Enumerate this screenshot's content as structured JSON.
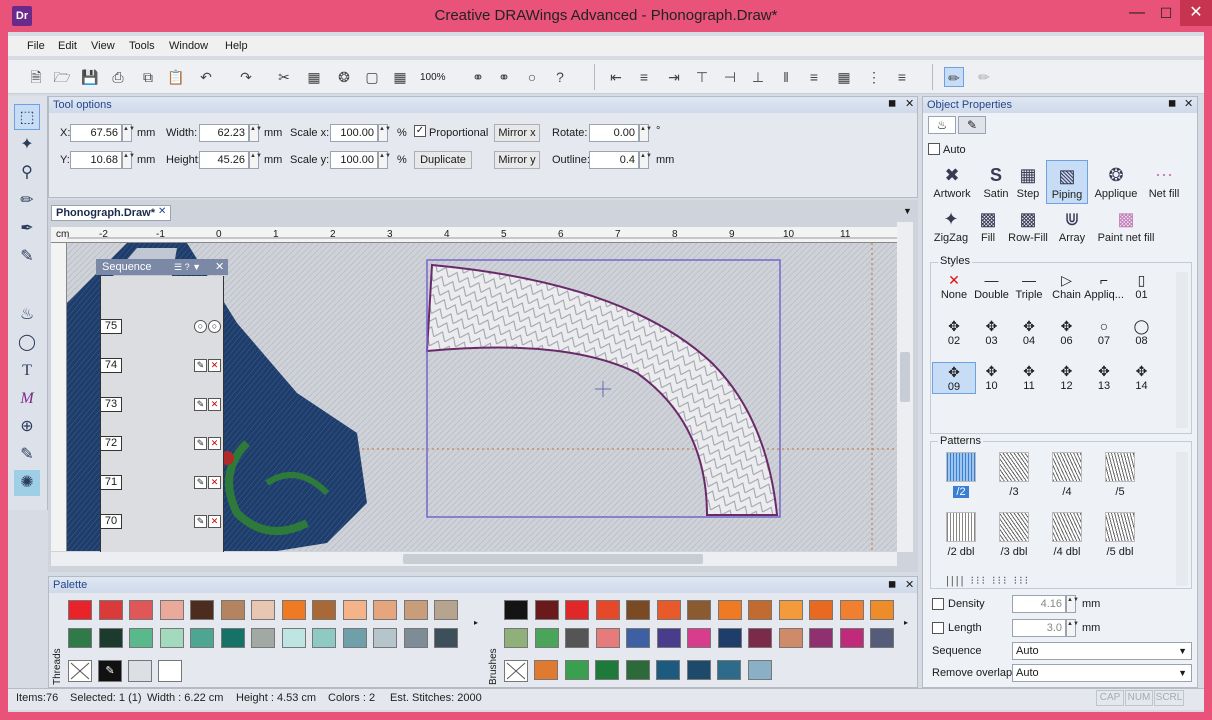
{
  "window": {
    "title": "Creative DRAWings Advanced - Phonograph.Draw*",
    "app_icon": "Dr"
  },
  "menu": [
    "File",
    "Edit",
    "View",
    "Tools",
    "Window",
    "Help"
  ],
  "toolbar": {
    "zoom": "100%"
  },
  "tool_options": {
    "title": "Tool options",
    "x_label": "X:",
    "x_value": "67.56",
    "x_unit": "mm",
    "y_label": "Y:",
    "y_value": "10.68",
    "y_unit": "mm",
    "width_label": "Width:",
    "width_value": "62.23",
    "width_unit": "mm",
    "height_label": "Height:",
    "height_value": "45.26",
    "height_unit": "mm",
    "scalex_label": "Scale x:",
    "scalex_value": "100.00",
    "scalex_unit": "%",
    "scaley_label": "Scale y:",
    "scaley_value": "100.00",
    "scaley_unit": "%",
    "proportional_label": "Proportional",
    "proportional_checked": true,
    "duplicate_label": "Duplicate",
    "mirrorx_label": "Mirror x",
    "mirrory_label": "Mirror y",
    "rotate_label": "Rotate:",
    "rotate_value": "0.00",
    "rotate_unit": "°",
    "outline_label": "Outline:",
    "outline_value": "0.4",
    "outline_unit": "mm"
  },
  "document": {
    "tab_label": "Phonograph.Draw*",
    "ruler_unit": "cm",
    "ruler_ticks": [
      "-2",
      "-1",
      "0",
      "1",
      "2",
      "3",
      "4",
      "5",
      "6",
      "7",
      "8",
      "9",
      "10",
      "11"
    ]
  },
  "sequence": {
    "title": "Sequence",
    "rows": [
      "75",
      "74",
      "73",
      "72",
      "71",
      "70"
    ]
  },
  "palette": {
    "title": "Palette",
    "threads_label": "Threads",
    "brushes_label": "Brushes",
    "threads_row1": [
      "#e8242a",
      "#d93b3b",
      "#e05757",
      "#e9a99b",
      "#4d2c20",
      "#b3845f",
      "#e8c7b2",
      "#ef7a24",
      "#a86838",
      "#f5b38a",
      "#e5a67d",
      "#c89d7a",
      "#b7a48f"
    ],
    "threads_row2": [
      "#2e7a48",
      "#1d3a2e",
      "#5ab98c",
      "#a3d9bd",
      "#4ea591",
      "#167267",
      "#a2a9a4",
      "#bfe5e2",
      "#8fc9c3",
      "#6f9fa9",
      "#b6c4cc",
      "#7d8c96",
      "#3d4f5a"
    ],
    "brushes_row1": [
      "#141414",
      "#6a1a1a",
      "#e12828",
      "#e8482a",
      "#7a4a24",
      "#e85a2a",
      "#8a5a30",
      "#ef7a24",
      "#c26b30",
      "#f29a3c",
      "#e86a20",
      "#f08030",
      "#ef8c2a"
    ],
    "brushes_row2": [
      "#8fb07a",
      "#4aa55a",
      "#555555",
      "#e77b7b",
      "#3d5fa3",
      "#4a3c8c",
      "#d83c8c",
      "#1f3d6a",
      "#7b2a4a",
      "#cf8a6a",
      "#903070",
      "#c02a7a",
      "#555c7a"
    ],
    "brushes_row3": [
      "#e07a30",
      "#3aa050",
      "#1e7a3a",
      "#2c6a3a",
      "#1d5a80",
      "#1d4a6a",
      "#2e6a8a",
      "#8ab0c8"
    ]
  },
  "object_properties": {
    "title": "Object Properties",
    "auto_label": "Auto",
    "types_row1": [
      {
        "label": "Artwork",
        "icon": "artwork-icon"
      },
      {
        "label": "Satin",
        "icon": "satin-icon"
      },
      {
        "label": "Step",
        "icon": "step-icon"
      },
      {
        "label": "Piping",
        "icon": "piping-icon"
      },
      {
        "label": "Applique",
        "icon": "applique-icon"
      },
      {
        "label": "Net fill",
        "icon": "netfill-icon"
      }
    ],
    "types_row2": [
      {
        "label": "ZigZag",
        "icon": "zigzag-icon"
      },
      {
        "label": "Fill",
        "icon": "fill-icon"
      },
      {
        "label": "Row-Fill",
        "icon": "rowfill-icon"
      },
      {
        "label": "Array",
        "icon": "array-icon"
      },
      {
        "label": "Paint net fill",
        "icon": "paintnetfill-icon"
      }
    ],
    "styles_title": "Styles",
    "styles_row1": [
      "None",
      "Double",
      "Triple",
      "Chain",
      "Appliq...",
      "01"
    ],
    "styles_row2": [
      "02",
      "03",
      "04",
      "06",
      "07",
      "08"
    ],
    "styles_row3": [
      "09",
      "10",
      "11",
      "12",
      "13",
      "14"
    ],
    "patterns_title": "Patterns",
    "patterns_row1": [
      "/2",
      "/3",
      "/4",
      "/5"
    ],
    "patterns_row2": [
      "/2 dbl",
      "/3 dbl",
      "/4 dbl",
      "/5 dbl"
    ],
    "density_label": "Density",
    "density_value": "4.16",
    "density_unit": "mm",
    "length_label": "Length",
    "length_value": "3.0",
    "length_unit": "mm",
    "sequence_label": "Sequence",
    "sequence_value": "Auto",
    "overlaps_label": "Remove overlaps",
    "overlaps_value": "Auto"
  },
  "status": {
    "items": "Items:76",
    "selected": "Selected: 1 (1)",
    "width": "Width : 6.22 cm",
    "height": "Height : 4.53 cm",
    "colors": "Colors : 2",
    "stitches": "Est. Stitches: 2000",
    "cap": "CAP",
    "num": "NUM",
    "scrl": "SCRL"
  }
}
